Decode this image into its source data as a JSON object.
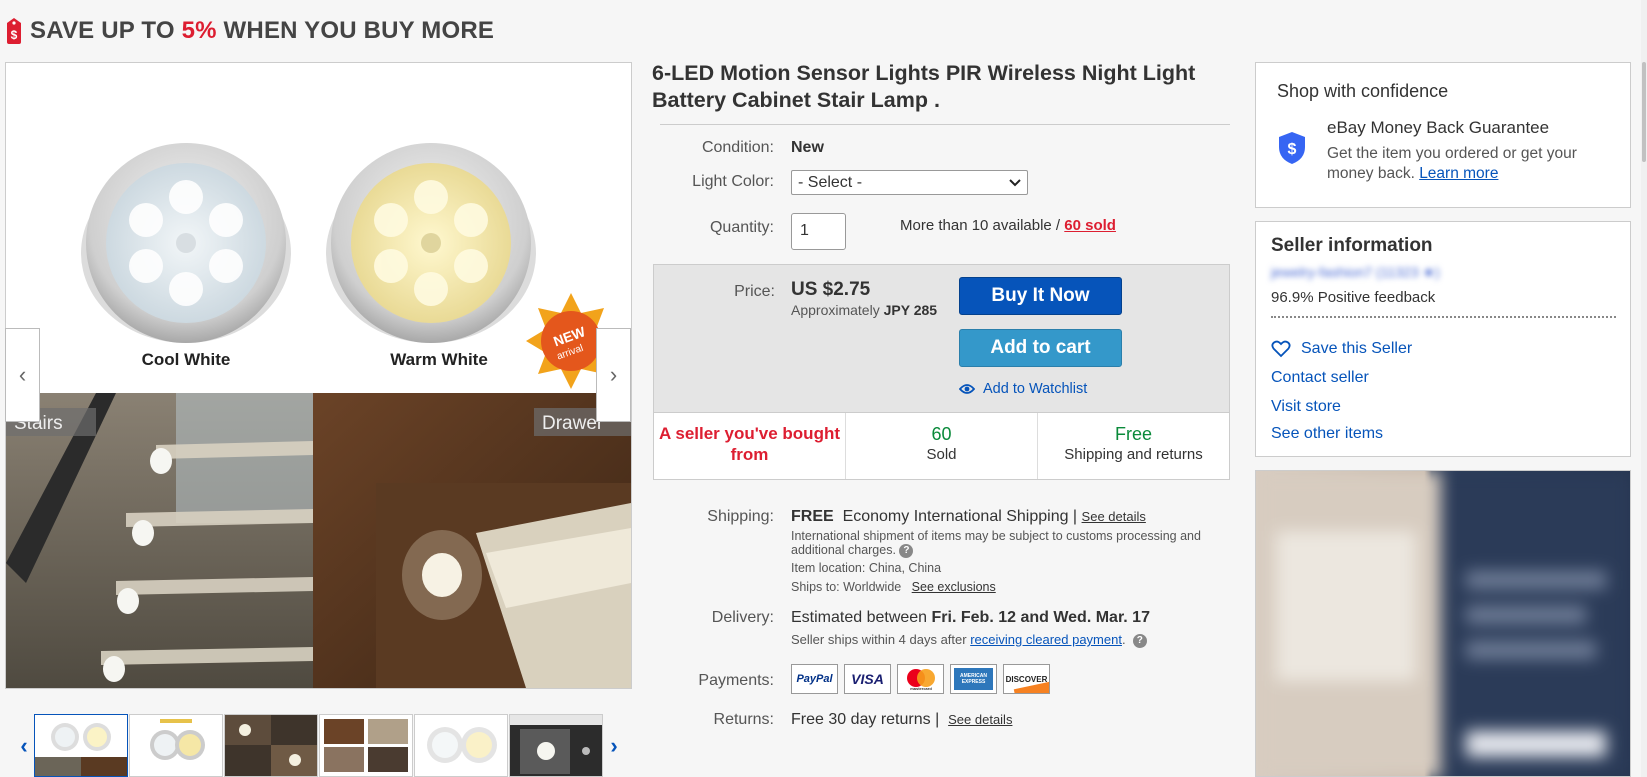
{
  "banner": {
    "text_before": "SAVE UP TO ",
    "text_pct": "5%",
    "text_after": " WHEN YOU BUY MORE"
  },
  "gallery": {
    "image_labels": {
      "cool": "Cool White",
      "warm": "Warm White",
      "stairs": "Stairs",
      "drawer": "Drawer",
      "badge": "NEW arrival"
    },
    "prev_label": "‹",
    "next_label": "›",
    "thumb_prev": "‹",
    "thumb_next": "›"
  },
  "listing": {
    "title": "6-LED Motion Sensor Lights PIR Wireless Night Light Battery Cabinet Stair Lamp .",
    "condition_label": "Condition:",
    "condition_value": "New",
    "color_label": "Light Color:",
    "color_select": "- Select -",
    "quantity_label": "Quantity:",
    "quantity_value": "1",
    "avail_text": "More than 10 available / ",
    "sold_link": "60 sold"
  },
  "buybox": {
    "price_label": "Price:",
    "price": "US $2.75",
    "approx_prefix": "Approximately ",
    "approx_value": "JPY 285",
    "buy_now": "Buy It Now",
    "add_to_cart": "Add to cart",
    "watchlist": "Add to Watchlist",
    "stats": [
      {
        "big": "A seller you've bought from",
        "small": ""
      },
      {
        "big": "60",
        "small": "Sold"
      },
      {
        "big": "Free",
        "small": "Shipping and returns"
      }
    ]
  },
  "details": {
    "shipping_label": "Shipping:",
    "shipping_free": "FREE",
    "shipping_service": "Economy International Shipping |",
    "see_details": "See details",
    "intl_note": "International shipment of items may be subject to customs processing and additional charges.",
    "item_location": "Item location:  China, China",
    "ships_to": "Ships to:  Worldwide",
    "see_exclusions": "See exclusions",
    "delivery_label": "Delivery:",
    "delivery_prefix": "Estimated between ",
    "delivery_dates": "Fri. Feb. 12 and Wed. Mar. 17",
    "ships_within": "Seller ships within 4 days after ",
    "cleared_payment": "receiving cleared payment",
    "payments_label": "Payments:",
    "payment_methods": [
      "PayPal",
      "VISA",
      "mastercard",
      "AMERICAN EXPRESS",
      "DISCOVER"
    ],
    "returns_label": "Returns:",
    "returns_value": "Free 30 day returns |",
    "returns_see_details": "See details"
  },
  "confidence": {
    "title": "Shop with confidence",
    "guarantee": "eBay Money Back Guarantee",
    "desc": "Get the item you ordered or get your money back. ",
    "learn_more": "Learn more"
  },
  "seller": {
    "title": "Seller information",
    "name_blurred": "jewelry-fashion7 (11323 ★)",
    "feedback": "96.9% Positive feedback",
    "save": "Save this Seller",
    "contact": "Contact seller",
    "visit": "Visit store",
    "other": "See other items"
  },
  "colors": {
    "accent_blue": "#0654ba",
    "cart_blue": "#3498ca",
    "red": "#dd1e31",
    "green": "#0a8a3a"
  }
}
